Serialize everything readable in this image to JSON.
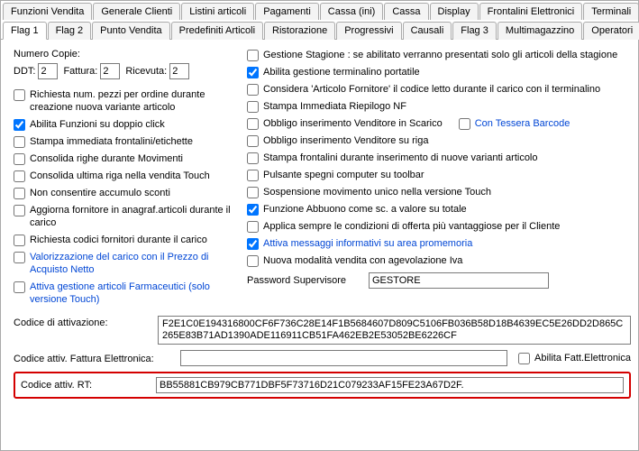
{
  "tabsTop": [
    "Funzioni Vendita",
    "Generale Clienti",
    "Listini articoli",
    "Pagamenti",
    "Cassa (ini)",
    "Cassa",
    "Display",
    "Frontalini Elettronici",
    "Terminali"
  ],
  "tabsBottom": [
    "Flag 1",
    "Flag 2",
    "Punto Vendita",
    "Predefiniti Articoli",
    "Ristorazione",
    "Progressivi",
    "Causali",
    "Flag 3",
    "Multimagazzino",
    "Operatori"
  ],
  "activeTab": "Flag 1",
  "labels": {
    "numeroCopie": "Numero Copie:",
    "ddt": "DDT:",
    "fattura": "Fattura:",
    "ricevuta": "Ricevuta:",
    "passwordSupervisore": "Password Supervisore",
    "codiceAttivazione": "Codice di attivazione:",
    "codiceFattElettr": "Codice attiv. Fattura Elettronica:",
    "abilitaFattElettr": "Abilita Fatt.Elettronica",
    "codiceRT": "Codice attiv. RT:",
    "conTesseraBarcode": "Con Tessera Barcode"
  },
  "values": {
    "ddt": "2",
    "fattura": "2",
    "ricevuta": "2",
    "passwordSupervisore": "GESTORE",
    "codiceAttivazione": "F2E1C0E194316800CF6F736C28E14F1B5684607D809C5106FB036B58D18B4639EC5E26DD2D865C265E83B71AD1390ADE116911CB51FA462EB2E53052BE6226CF",
    "codiceFattElettr": "",
    "codiceRT": "BB55881CB979CB771DBF5F73716D21C079233AF15FE23A67D2F."
  },
  "leftChecks": [
    {
      "label": "Richiesta num. pezzi per ordine durante creazione nuova variante articolo",
      "checked": false
    },
    {
      "label": "Abilita Funzioni su doppio click",
      "checked": true
    },
    {
      "label": "Stampa immediata frontalini/etichette",
      "checked": false
    },
    {
      "label": "Consolida righe durante Movimenti",
      "checked": false
    },
    {
      "label": "Consolida ultima riga nella vendita Touch",
      "checked": false
    },
    {
      "label": "Non consentire accumulo sconti",
      "checked": false
    },
    {
      "label": "Aggiorna fornitore in anagraf.articoli durante il carico",
      "checked": false
    },
    {
      "label": "Richiesta codici fornitori durante il carico",
      "checked": false
    },
    {
      "label": "Valorizzazione del carico con il Prezzo di Acquisto Netto",
      "checked": false,
      "blue": true
    },
    {
      "label": "Attiva gestione articoli Farmaceutici (solo versione Touch)",
      "checked": false,
      "blue": true
    }
  ],
  "rightChecks": [
    {
      "label": "Gestione Stagione : se abilitato verranno presentati solo gli articoli della stagione",
      "checked": false
    },
    {
      "label": "Abilita gestione terminalino portatile",
      "checked": true
    },
    {
      "label": "Considera 'Articolo Fornitore'  il codice letto durante il carico con il terminalino",
      "checked": false
    },
    {
      "label": "Stampa Immediata Riepilogo NF",
      "checked": false
    },
    {
      "label": "Obbligo inserimento Venditore in Scarico",
      "checked": false,
      "extra": "tessera"
    },
    {
      "label": "Obbligo inserimento Venditore su riga",
      "checked": false
    },
    {
      "label": "Stampa frontalini durante inserimento di nuove varianti articolo",
      "checked": false
    },
    {
      "label": "Pulsante spegni computer su toolbar",
      "checked": false
    },
    {
      "label": "Sospensione movimento unico nella versione Touch",
      "checked": false
    },
    {
      "label": "Funzione Abbuono come sc. a valore su totale",
      "checked": true
    },
    {
      "label": "Applica sempre le condizioni di offerta più vantaggiose per il Cliente",
      "checked": false
    },
    {
      "label": "Attiva messaggi informativi su area promemoria",
      "checked": true,
      "blue": true
    },
    {
      "label": "Nuova modalità vendita con agevolazione Iva",
      "checked": false
    }
  ]
}
